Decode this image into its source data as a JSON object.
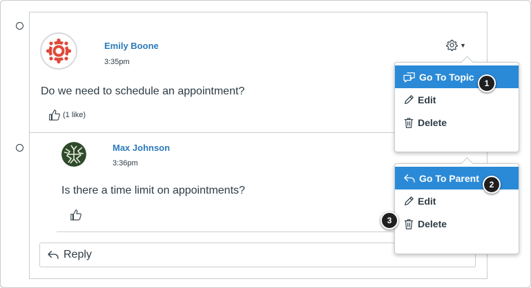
{
  "posts": [
    {
      "author": "Emily Boone",
      "time": "3:35pm",
      "message": "Do we need to schedule an appointment?",
      "like_count": "(1 like)"
    },
    {
      "author": "Max Johnson",
      "time": "3:36pm",
      "message": "Is there a time limit on appointments?"
    }
  ],
  "reply": {
    "label": "Reply"
  },
  "menu_topic": {
    "items": [
      {
        "label": "Go To Topic",
        "icon": "discussion-icon"
      },
      {
        "label": "Edit",
        "icon": "pencil-icon"
      },
      {
        "label": "Delete",
        "icon": "trash-icon"
      }
    ]
  },
  "menu_parent": {
    "items": [
      {
        "label": "Go To Parent",
        "icon": "reply-arrow-icon"
      },
      {
        "label": "Edit",
        "icon": "pencil-icon"
      },
      {
        "label": "Delete",
        "icon": "trash-icon"
      }
    ]
  },
  "callouts": [
    "1",
    "2",
    "3"
  ],
  "colors": {
    "link": "#2b7abc",
    "active_menu": "#2b8ad7",
    "text": "#2d3b45",
    "border": "#c7cdd1",
    "avatar_accent": "#e0483a"
  }
}
